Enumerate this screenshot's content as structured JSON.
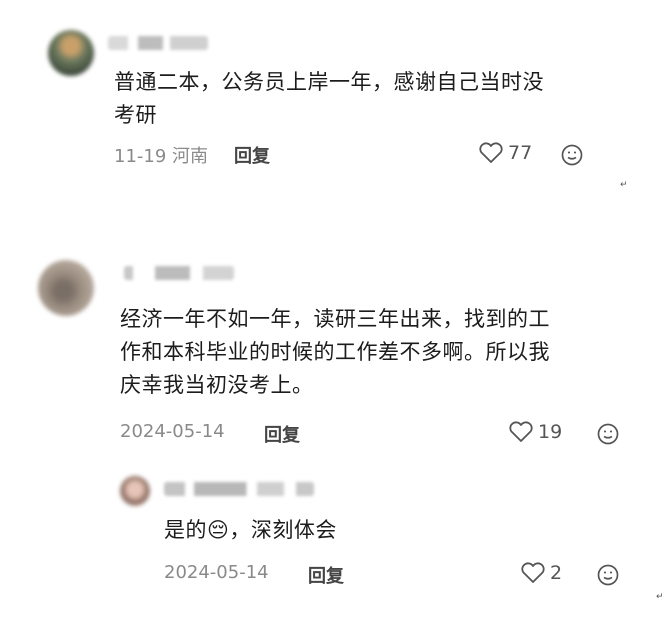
{
  "comments": [
    {
      "text_line1": "普通二本，公务员上岸一年，感谢自己当时没",
      "text_line2": "考研",
      "date": "11-19",
      "location": "河南",
      "reply_label": "回复",
      "likes": "77"
    },
    {
      "text_line1": "经济一年不如一年，读研三年出来，找到的工",
      "text_line2": "作和本科毕业的时候的工作差不多啊。所以我",
      "text_line3": "庆幸我当初没考上。",
      "date": "2024-05-14",
      "reply_label": "回复",
      "likes": "19"
    }
  ],
  "reply": {
    "text_before": "是的",
    "emoji": "😔",
    "text_after": "，深刻体会",
    "date": "2024-05-14",
    "reply_label": "回复",
    "likes": "2"
  },
  "colors": {
    "text": "#1c1c1c",
    "meta": "#8a8a8a",
    "icon": "#555555"
  }
}
